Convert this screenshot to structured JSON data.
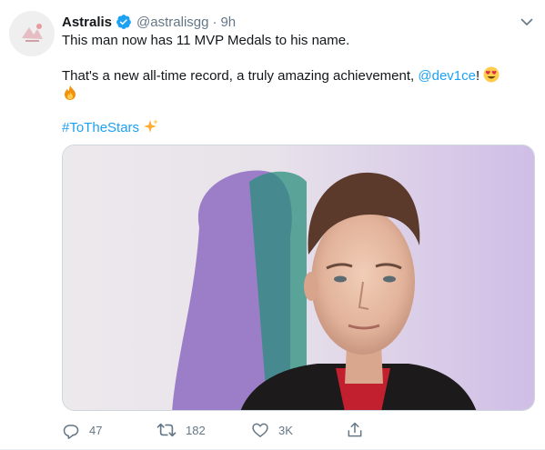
{
  "tweet": {
    "display_name": "Astralis",
    "handle": "@astralisgg",
    "separator": "·",
    "time": "9h",
    "line1": "This man now has 11 MVP Medals to his name.",
    "line2_prefix": "That's a new all-time record, a truly amazing achievement, ",
    "mention": "@dev1ce",
    "line2_suffix": "!",
    "hashtag": "#ToTheStars",
    "icons": {
      "verified": "verified-badge-icon",
      "menu": "chevron-down-icon",
      "emoji_heart_eyes": "heart-eyes-emoji",
      "emoji_fire": "fire-emoji",
      "emoji_sparkles": "sparkles-emoji"
    },
    "colors": {
      "link": "#1da1f2",
      "secondary_text": "#657786",
      "primary_text": "#14171a"
    }
  },
  "actions": {
    "reply_count": "47",
    "retweet_count": "182",
    "like_count": "3K",
    "icons": [
      "reply-icon",
      "retweet-icon",
      "like-icon",
      "share-icon"
    ]
  }
}
